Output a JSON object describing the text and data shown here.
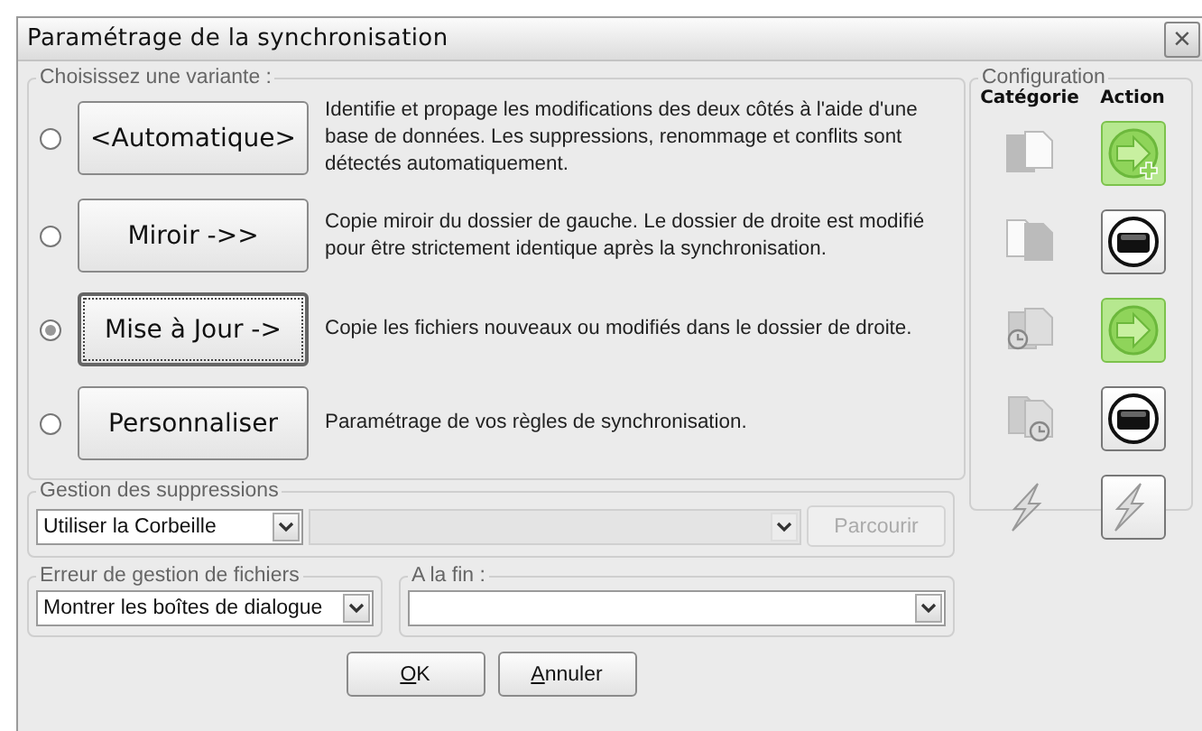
{
  "window": {
    "title": "Paramétrage de la synchronisation",
    "close": "×"
  },
  "variants_group": {
    "legend": "Choisissez une variante :",
    "items": [
      {
        "label": "<Automatique>",
        "description": "Identifie et propage les modifications des deux côtés à l'aide d'une base de données. Les suppressions, renommage et conflits sont détectés automatiquement.",
        "selected": false
      },
      {
        "label": "Miroir ->>",
        "description": "Copie miroir du dossier de gauche. Le dossier de droite est modifié pour être strictement identique après la synchronisation.",
        "selected": false
      },
      {
        "label": "Mise à Jour ->",
        "description": "Copie les fichiers nouveaux ou modifiés dans le dossier de droite.",
        "selected": true
      },
      {
        "label": "Personnaliser",
        "description": "Paramétrage de vos règles de synchronisation.",
        "selected": false
      }
    ]
  },
  "configuration": {
    "legend": "Configuration",
    "columns": [
      "Catégorie",
      "Action"
    ],
    "rows": [
      {
        "category": {
          "kind": "left-only"
        },
        "action": {
          "kind": "create"
        }
      },
      {
        "category": {
          "kind": "right-only"
        },
        "action": {
          "kind": "remove"
        }
      },
      {
        "category": {
          "kind": "left-newer"
        },
        "action": {
          "kind": "overwrite"
        }
      },
      {
        "category": {
          "kind": "right-newer"
        },
        "action": {
          "kind": "remove"
        }
      },
      {
        "category": {
          "kind": "conflict"
        },
        "action": {
          "kind": "conflict"
        }
      }
    ]
  },
  "deletion": {
    "legend": "Gestion des suppressions",
    "select": "Utiliser la Corbeille",
    "folder_disabled": true,
    "browse": "Parcourir"
  },
  "file_errors": {
    "legend": "Erreur de gestion de fichiers",
    "select": "Montrer les boîtes de dialogue"
  },
  "on_completion": {
    "legend": "A la fin :"
  },
  "buttons": [
    {
      "mnemonic": "O",
      "rest": "K"
    },
    {
      "mnemonic": "A",
      "rest": "nnuler"
    }
  ]
}
